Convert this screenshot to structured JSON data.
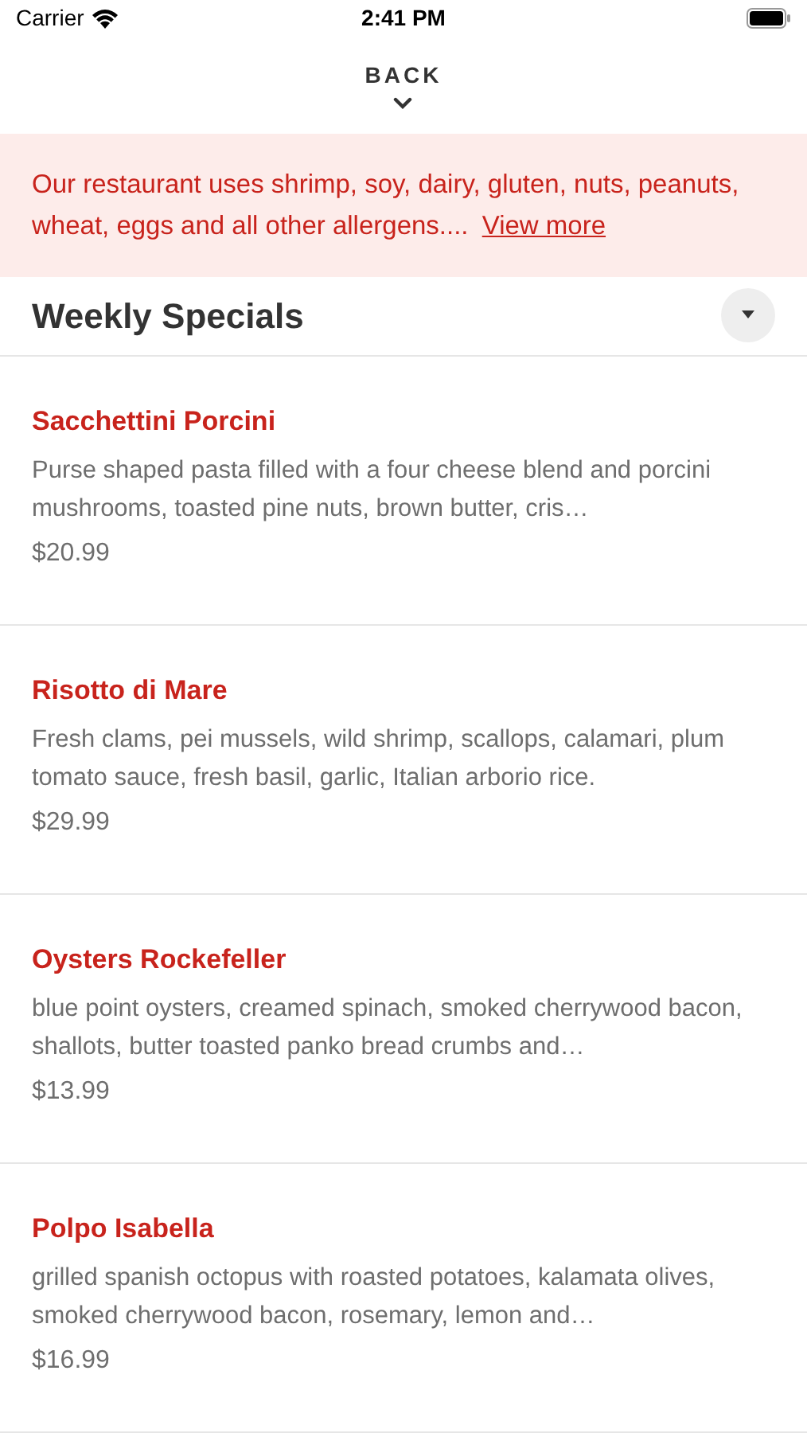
{
  "status_bar": {
    "carrier": "Carrier",
    "time": "2:41 PM"
  },
  "nav": {
    "back": "BACK"
  },
  "notice": {
    "text": "Our restaurant uses shrimp, soy, dairy, gluten, nuts, peanuts, wheat, eggs and all other allergens....",
    "link": "View more"
  },
  "section": {
    "title": "Weekly Specials",
    "expanded": false
  },
  "items": [
    {
      "name": "Sacchettini Porcini",
      "description": "Purse shaped pasta filled with a four cheese blend and porcini mushrooms, toasted pine nuts, brown butter, cris…",
      "price": "$20.99"
    },
    {
      "name": "Risotto di Mare",
      "description": "Fresh clams, pei mussels, wild shrimp, scallops, calamari, plum tomato sauce, fresh basil, garlic, Italian arborio rice.",
      "price": "$29.99"
    },
    {
      "name": "Oysters Rockefeller",
      "description": "blue point oysters, creamed spinach, smoked cherrywood bacon, shallots, butter toasted panko bread crumbs and…",
      "price": "$13.99"
    },
    {
      "name": "Polpo Isabella",
      "description": "grilled spanish octopus with roasted potatoes, kalamata olives, smoked cherrywood bacon, rosemary, lemon and…",
      "price": "$16.99"
    }
  ]
}
